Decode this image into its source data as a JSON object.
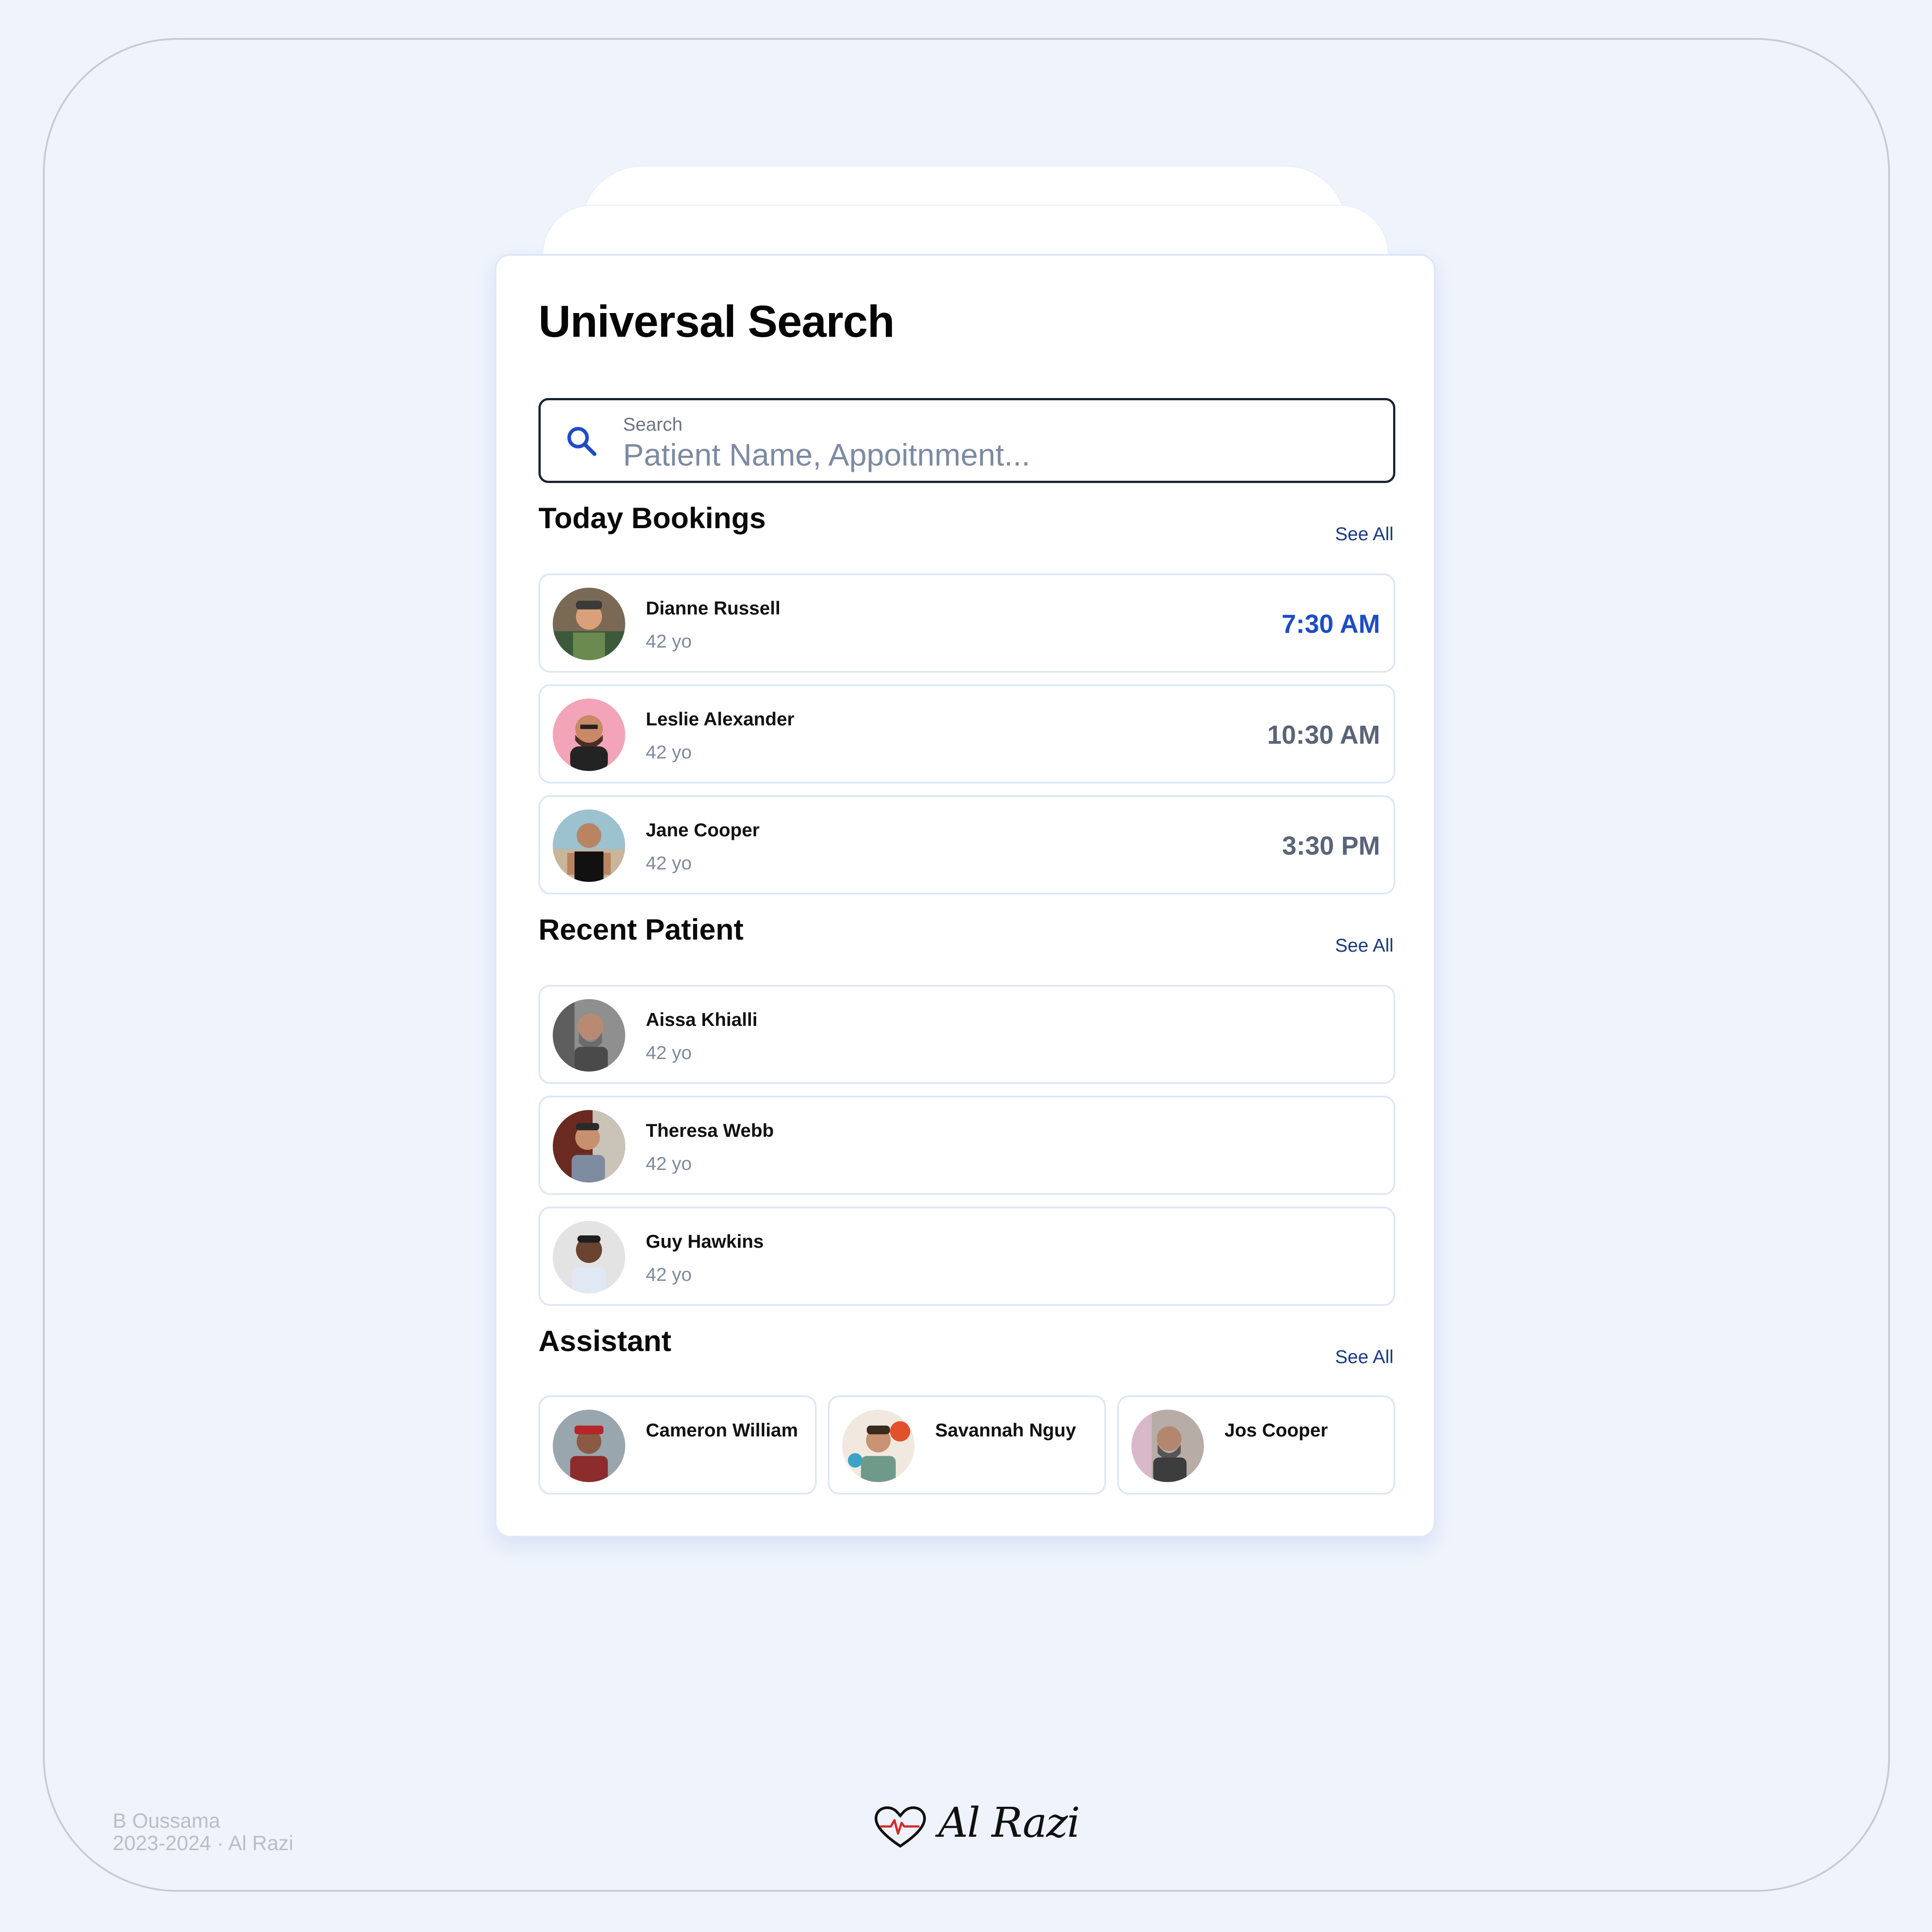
{
  "page": {
    "title": "Universal Search",
    "accent_color": "#1f4cc4"
  },
  "search": {
    "label": "Search",
    "placeholder": "Patient Name, Appoitnment...",
    "icon": "search-icon"
  },
  "bookings": {
    "title": "Today Bookings",
    "see_all": "See All",
    "items": [
      {
        "name": "Dianne Russell",
        "age": "42 yo",
        "time": "7:30 AM",
        "highlighted": true
      },
      {
        "name": "Leslie Alexander",
        "age": "42 yo",
        "time": "10:30 AM",
        "highlighted": false
      },
      {
        "name": "Jane Cooper",
        "age": "42 yo",
        "time": "3:30 PM",
        "highlighted": false
      }
    ]
  },
  "recent": {
    "title": "Recent Patient",
    "see_all": "See All",
    "items": [
      {
        "name": "Aissa Khialli",
        "age": "42 yo"
      },
      {
        "name": "Theresa Webb",
        "age": "42 yo"
      },
      {
        "name": "Guy Hawkins",
        "age": "42 yo"
      }
    ]
  },
  "assistant": {
    "title": "Assistant",
    "see_all": "See All",
    "items": [
      {
        "name": "Cameron William"
      },
      {
        "name": "Savannah Nguy"
      },
      {
        "name": "Jos Cooper"
      }
    ]
  },
  "footer": {
    "credit_line1": "B Oussama",
    "credit_line2": "2023-2024 · Al Razi",
    "brand": "Al Razi",
    "brand_icon": "heart-pulse-icon"
  }
}
